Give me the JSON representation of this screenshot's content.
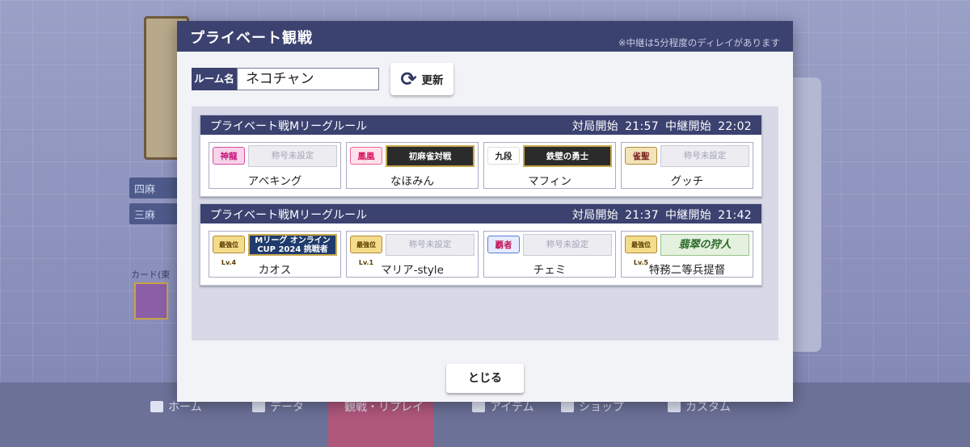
{
  "modal": {
    "title": "プライベート観戦",
    "delay_note": "※中継は5分程度のディレイがあります",
    "room_label": "ルーム名",
    "room_name": "ネコチャン",
    "refresh_label": "更新",
    "close_label": "とじる"
  },
  "matches": [
    {
      "rule": "プライベート戦Mリーグルール",
      "start_label": "対局開始",
      "start_time": "21:57",
      "relay_label": "中継開始",
      "relay_time": "22:02",
      "players": [
        {
          "name": "アベキング",
          "rank": "神龍",
          "title": "称号未設定"
        },
        {
          "name": "なほみん",
          "rank": "鳳凰",
          "title": "初麻雀対戦"
        },
        {
          "name": "マフィン",
          "rank": "九段",
          "title": "鉄壁の勇士"
        },
        {
          "name": "グッチ",
          "rank": "雀聖",
          "title": "称号未設定"
        }
      ]
    },
    {
      "rule": "プライベート戦Mリーグルール",
      "start_label": "対局開始",
      "start_time": "21:37",
      "relay_label": "中継開始",
      "relay_time": "21:42",
      "players": [
        {
          "name": "カオス",
          "rank": "最強位Lv.4",
          "title": "Mリーグ オンラインCUP 2024 挑戦者"
        },
        {
          "name": "マリア-style",
          "rank": "最強位Lv.1",
          "title": "称号未設定"
        },
        {
          "name": "チェミ",
          "rank": "覇者",
          "title": "称号未設定"
        },
        {
          "name": "特務二等兵提督",
          "rank": "最強位Lv.5",
          "title": "翡翠の狩人"
        }
      ]
    }
  ],
  "background": {
    "tag_1": "四麻",
    "tag_2": "三麻",
    "card_label": "カード(東",
    "nav": [
      "ホーム",
      "データ",
      "観戦・リプレイ",
      "アイテム",
      "ショップ",
      "カスタム"
    ]
  }
}
